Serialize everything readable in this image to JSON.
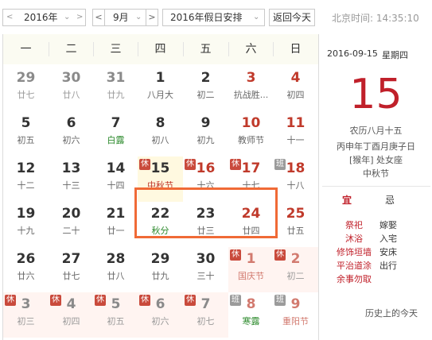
{
  "toolbar": {
    "year_value": "2016年",
    "month_value": "9月",
    "holiday_value": "2016年假日安排",
    "prev_arrow": "<",
    "next_arrow": ">",
    "chevron": "⌄",
    "back_today": "返回今天",
    "clock": "北京时间: 14:35:10"
  },
  "weekdays": [
    "一",
    "二",
    "三",
    "四",
    "五",
    "六",
    "日"
  ],
  "days": [
    {
      "n": "29",
      "l": "廿七",
      "other": true
    },
    {
      "n": "30",
      "l": "廿八",
      "other": true
    },
    {
      "n": "31",
      "l": "廿九",
      "other": true
    },
    {
      "n": "1",
      "l": "八月大"
    },
    {
      "n": "2",
      "l": "初二"
    },
    {
      "n": "3",
      "l": "抗战胜...",
      "wkd": true
    },
    {
      "n": "4",
      "l": "初四",
      "wkd": true
    },
    {
      "n": "5",
      "l": "初五"
    },
    {
      "n": "6",
      "l": "初六"
    },
    {
      "n": "7",
      "l": "白露",
      "term": true
    },
    {
      "n": "8",
      "l": "初八"
    },
    {
      "n": "9",
      "l": "初九"
    },
    {
      "n": "10",
      "l": "教师节",
      "wkd": true
    },
    {
      "n": "11",
      "l": "十一",
      "wkd": true
    },
    {
      "n": "12",
      "l": "十二"
    },
    {
      "n": "13",
      "l": "十三"
    },
    {
      "n": "14",
      "l": "十四"
    },
    {
      "n": "15",
      "l": "中秋节",
      "fest": true,
      "badge": "休",
      "today": true
    },
    {
      "n": "16",
      "l": "十六",
      "badge": "休",
      "wkd": true
    },
    {
      "n": "17",
      "l": "十七",
      "badge": "休",
      "wkd": true
    },
    {
      "n": "18",
      "l": "十八",
      "badge": "班",
      "work": true,
      "wkd": true
    },
    {
      "n": "19",
      "l": "十九"
    },
    {
      "n": "20",
      "l": "二十"
    },
    {
      "n": "21",
      "l": "廿一"
    },
    {
      "n": "22",
      "l": "秋分",
      "term": true
    },
    {
      "n": "23",
      "l": "廿三"
    },
    {
      "n": "24",
      "l": "廿四",
      "wkd": true
    },
    {
      "n": "25",
      "l": "廿五",
      "wkd": true
    },
    {
      "n": "26",
      "l": "廿六"
    },
    {
      "n": "27",
      "l": "廿七"
    },
    {
      "n": "28",
      "l": "廿八"
    },
    {
      "n": "29",
      "l": "廿九"
    },
    {
      "n": "30",
      "l": "三十"
    },
    {
      "n": "1",
      "l": "国庆节",
      "other": true,
      "wkd": true,
      "fest": true,
      "badge": "休",
      "holi": true
    },
    {
      "n": "2",
      "l": "初二",
      "other": true,
      "wkd": true,
      "badge": "休",
      "holi": true
    },
    {
      "n": "3",
      "l": "初三",
      "other": true,
      "badge": "休",
      "holi": true
    },
    {
      "n": "4",
      "l": "初四",
      "other": true,
      "badge": "休",
      "holi": true
    },
    {
      "n": "5",
      "l": "初五",
      "other": true,
      "badge": "休",
      "holi": true
    },
    {
      "n": "6",
      "l": "初六",
      "other": true,
      "badge": "休",
      "holi": true
    },
    {
      "n": "7",
      "l": "初七",
      "other": true,
      "badge": "休",
      "holi": true
    },
    {
      "n": "8",
      "l": "寒露",
      "other": true,
      "wkd": true,
      "term": true,
      "badge": "班",
      "work": true
    },
    {
      "n": "9",
      "l": "重阳节",
      "other": true,
      "wkd": true,
      "fest": true,
      "badge": "班",
      "work": true
    }
  ],
  "panel": {
    "date": "2016-09-15",
    "weekday": "星期四",
    "big_day": "15",
    "lunar": "农历八月十五",
    "ganzhi": "丙申年丁酉月庚子日",
    "zodiac": "[猴年] 处女座",
    "festival": "中秋节",
    "yi_label": "宜",
    "ji_label": "忌",
    "yi": [
      "祭祀",
      "沐浴",
      "修饰垣墙",
      "平治道涂",
      "余事勿取"
    ],
    "ji": [
      "嫁娶",
      "入宅",
      "安床",
      "出行"
    ],
    "history": "历史上的今天"
  }
}
